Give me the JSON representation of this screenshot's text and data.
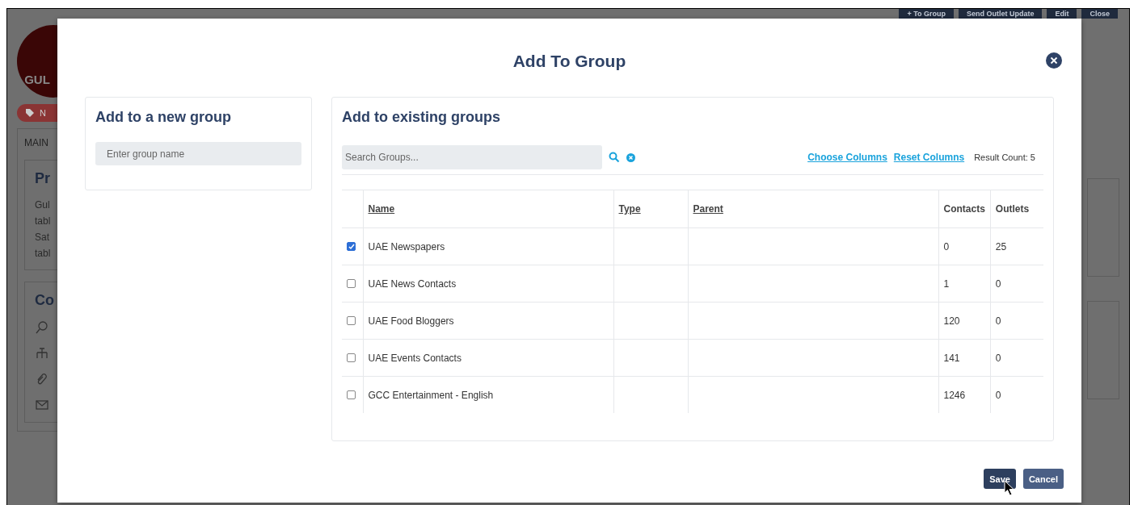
{
  "background": {
    "toolbar": [
      {
        "label": "+ To Group"
      },
      {
        "label": "Send Outlet Update"
      },
      {
        "label": "Edit"
      },
      {
        "label": "Close"
      }
    ],
    "logo_text": "GUL",
    "tag_text": "N",
    "tab": "MAIN",
    "profile_heading": "Pr",
    "profile_lines": [
      "Gul",
      "tabl",
      "Sat",
      "tabl"
    ],
    "contacts_heading": "Co"
  },
  "modal": {
    "title": "Add To Group",
    "new_group": {
      "heading": "Add to a new group",
      "placeholder": "Enter group name"
    },
    "existing": {
      "heading": "Add to existing groups",
      "search_placeholder": "Search Groups...",
      "links": [
        "Choose Columns",
        "Reset Columns"
      ],
      "result_count": "Result Count: 5",
      "columns": [
        {
          "label": "Name",
          "sortable": true
        },
        {
          "label": "Type",
          "sortable": true
        },
        {
          "label": "Parent",
          "sortable": true
        },
        {
          "label": "Contacts",
          "sortable": false
        },
        {
          "label": "Outlets",
          "sortable": false
        }
      ],
      "rows": [
        {
          "checked": true,
          "name": "UAE Newspapers",
          "contacts": "0",
          "outlets": "25"
        },
        {
          "checked": false,
          "name": "UAE News Contacts",
          "contacts": "1",
          "outlets": "0"
        },
        {
          "checked": false,
          "name": "UAE Food Bloggers",
          "contacts": "120",
          "outlets": "0"
        },
        {
          "checked": false,
          "name": "UAE Events Contacts",
          "contacts": "141",
          "outlets": "0"
        },
        {
          "checked": false,
          "name": "GCC Entertainment - English",
          "contacts": "1246",
          "outlets": "0"
        }
      ]
    },
    "buttons": [
      {
        "label": "Save",
        "kind": "primary"
      },
      {
        "label": "Cancel",
        "kind": "secondary"
      }
    ]
  }
}
